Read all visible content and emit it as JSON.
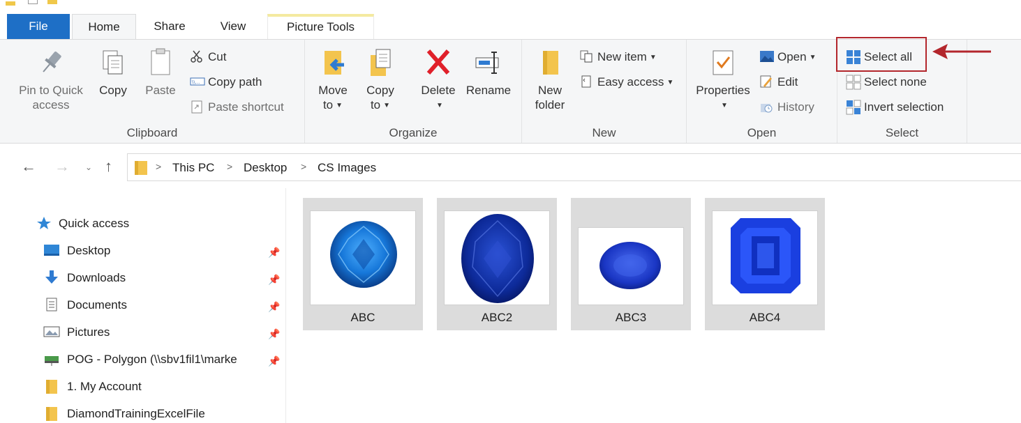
{
  "tabs": {
    "file": "File",
    "home": "Home",
    "share": "Share",
    "view": "View",
    "picture_tools": "Picture Tools"
  },
  "ribbon": {
    "clipboard": {
      "label": "Clipboard",
      "pin_line1": "Pin to Quick",
      "pin_line2": "access",
      "copy": "Copy",
      "paste": "Paste",
      "cut": "Cut",
      "copy_path": "Copy path",
      "paste_shortcut": "Paste shortcut"
    },
    "organize": {
      "label": "Organize",
      "move_line1": "Move",
      "move_line2": "to",
      "copy_line1": "Copy",
      "copy_line2": "to",
      "delete": "Delete",
      "rename": "Rename"
    },
    "new": {
      "label": "New",
      "new_folder_line1": "New",
      "new_folder_line2": "folder",
      "new_item": "New item",
      "easy_access": "Easy access"
    },
    "open": {
      "label": "Open",
      "properties": "Properties",
      "open": "Open",
      "edit": "Edit",
      "history": "History"
    },
    "select": {
      "label": "Select",
      "select_all": "Select all",
      "select_none": "Select none",
      "invert_selection": "Invert selection"
    }
  },
  "address": {
    "crumbs": [
      "This PC",
      "Desktop",
      "CS Images"
    ]
  },
  "nav": {
    "quick_access": "Quick access",
    "items": [
      {
        "label": "Desktop",
        "pinned": true
      },
      {
        "label": "Downloads",
        "pinned": true
      },
      {
        "label": "Documents",
        "pinned": true
      },
      {
        "label": "Pictures",
        "pinned": true
      },
      {
        "label": "POG - Polygon (\\\\sbv1fil1\\marke",
        "pinned": true
      },
      {
        "label": "1. My Account",
        "pinned": false
      },
      {
        "label": "DiamondTrainingExcelFile",
        "pinned": false
      }
    ]
  },
  "files": [
    {
      "name": "ABC",
      "shape": "round"
    },
    {
      "name": "ABC2",
      "shape": "oval"
    },
    {
      "name": "ABC3",
      "shape": "oval-small"
    },
    {
      "name": "ABC4",
      "shape": "emerald"
    }
  ],
  "colors": {
    "file_tab": "#1e6fc6",
    "highlight": "#b3262c",
    "sapphire": "#1a3fb8"
  }
}
